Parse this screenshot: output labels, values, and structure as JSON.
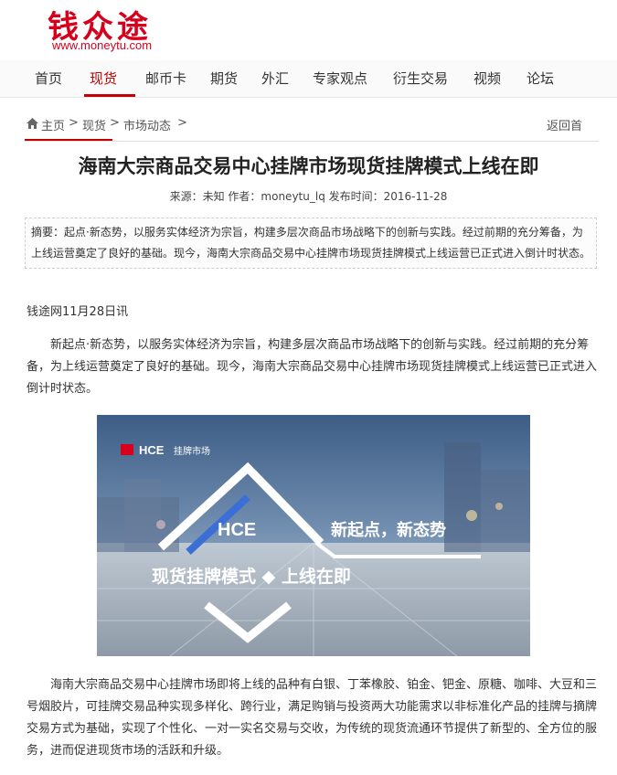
{
  "logo": {
    "chinese": "钱众途",
    "url": "www.moneytu.com"
  },
  "nav": {
    "items": [
      "首页",
      "现货",
      "邮币卡",
      "期货",
      "外汇",
      "专家观点",
      "衍生交易",
      "视频",
      "论坛"
    ],
    "active": "现货"
  },
  "breadcrumb": {
    "items": [
      "主页",
      "现货",
      "市场动态"
    ],
    "separator": ">",
    "back": "返回首"
  },
  "article": {
    "title": "海南大宗商品交易中心挂牌市场现货挂牌模式上线在即",
    "meta": "来源：未知  作者：moneytu_lq  发布时间：2016-11-28",
    "summary": "摘要：起点·新态势，以服务实体经济为宗旨，构建多层次商品市场战略下的创新与实践。经过前期的充分筹备，为上线运营奠定了良好的基础。现今，海南大宗商品交易中心挂牌市场现货挂牌模式上线运营已正式进入倒计时状态。",
    "dateline": "钱途网11月28日讯",
    "para1": "新起点·新态势，以服务实体经济为宗旨，构建多层次商品市场战略下的创新与实践。经过前期的充分筹备，为上线运营奠定了良好的基础。现今，海南大宗商品交易中心挂牌市场现货挂牌模式上线运营已正式进入倒计时状态。",
    "para2": "海南大宗商品交易中心挂牌市场即将上线的品种有白银、丁苯橡胶、铂金、钯金、原糖、咖啡、大豆和三号烟胶片，可挂牌交易品种实现多样化、跨行业，满足购销与投资两大功能需求以非标准化产品的挂牌与摘牌交易方式为基础，实现了个性化、一对一实名交易与交收，为传统的现货流通环节提供了新型的、全方位的服务，进而促进现货市场的活跃和升级。"
  },
  "banner": {
    "brand": "HCE",
    "brand_sub": "挂牌市场",
    "center_logo": "HCE",
    "slogan": "新起点，新态势",
    "headline": "现货挂牌模式 ◆ 上线在即"
  },
  "colors": {
    "accent": "#c40000",
    "logo_red": "#d6001c"
  }
}
